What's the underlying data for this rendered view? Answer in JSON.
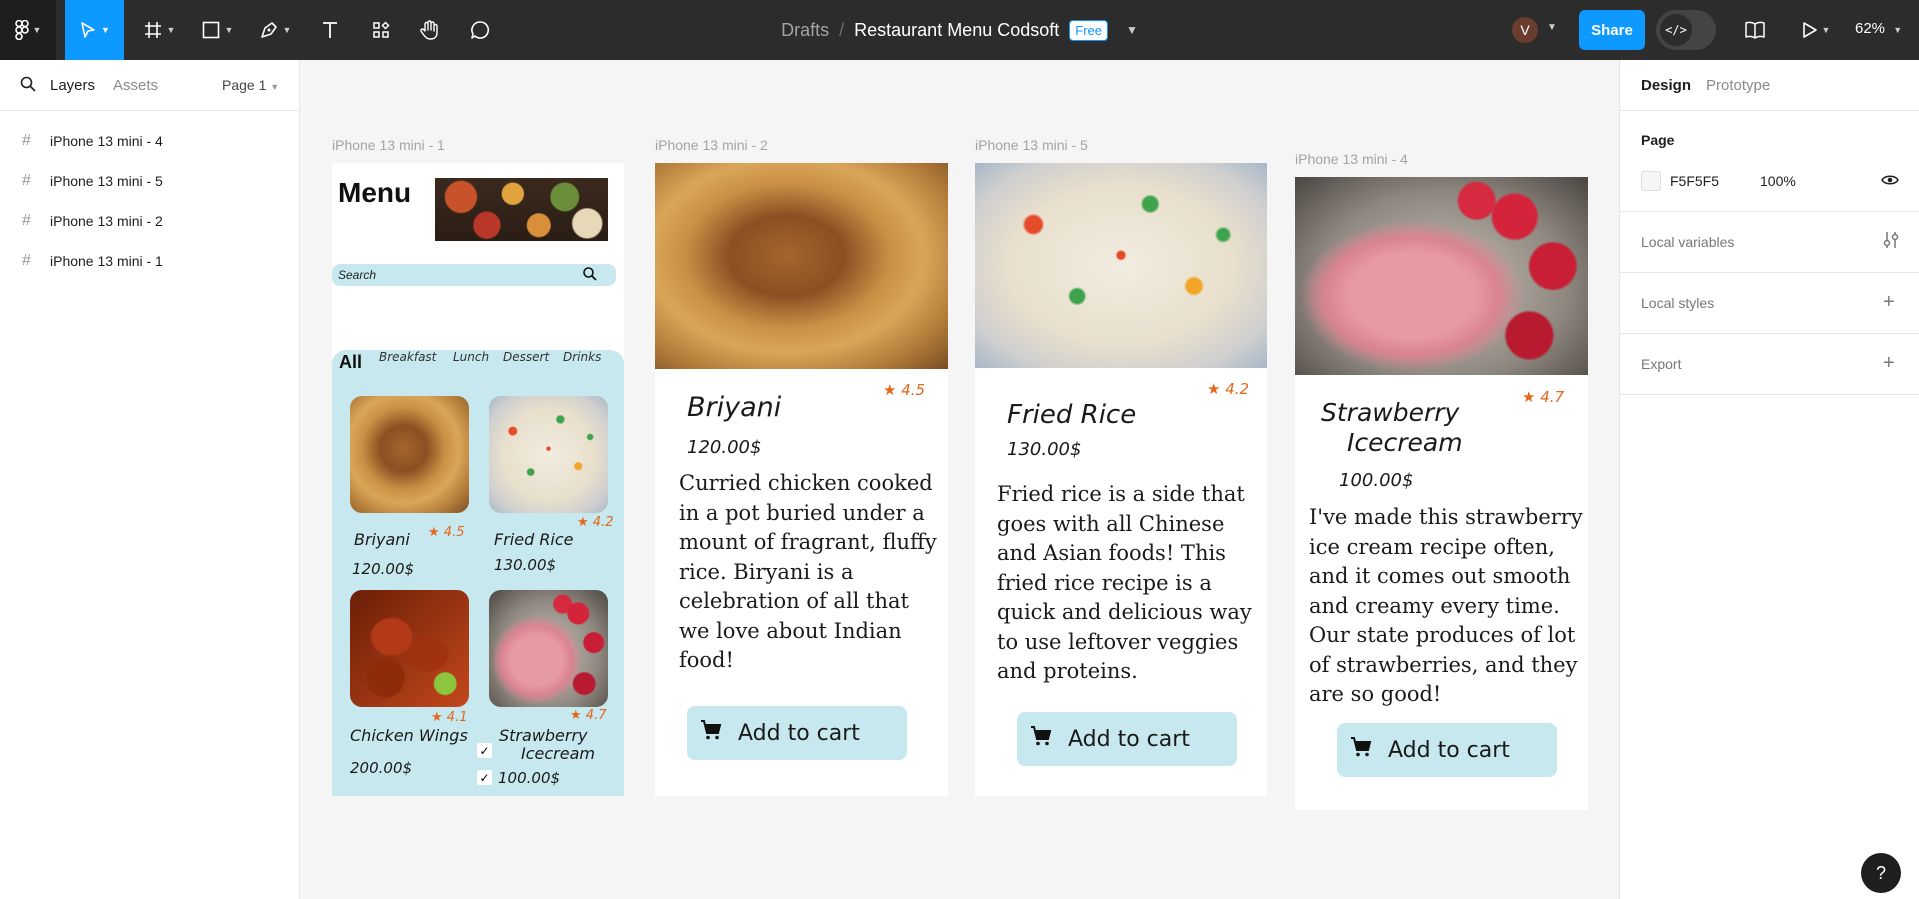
{
  "toolbar": {
    "file_location": "Drafts",
    "file_name": "Restaurant Menu Codsoft",
    "plan_badge": "Free",
    "avatar_initial": "V",
    "share_label": "Share",
    "zoom": "62%",
    "icons": [
      "figma-menu-icon",
      "move-tool-icon",
      "frame-tool-icon",
      "shape-tool-icon",
      "pen-tool-icon",
      "text-tool-icon",
      "resources-icon",
      "hand-tool-icon",
      "comment-icon",
      "dev-mode-icon",
      "library-icon",
      "present-icon"
    ]
  },
  "left_panel": {
    "tabs": {
      "layers": "Layers",
      "assets": "Assets"
    },
    "page_selector": "Page 1",
    "layers": [
      "iPhone 13 mini - 4",
      "iPhone 13 mini - 5",
      "iPhone 13 mini - 2",
      "iPhone 13 mini - 1"
    ]
  },
  "right_panel": {
    "tabs": {
      "design": "Design",
      "prototype": "Prototype"
    },
    "page_section": {
      "title": "Page",
      "color_hex": "F5F5F5",
      "opacity": "100%"
    },
    "sections": [
      "Local variables",
      "Local styles",
      "Export"
    ]
  },
  "canvas": {
    "frame1": {
      "label": "iPhone 13 mini - 1",
      "title": "Menu",
      "search_placeholder": "Search",
      "tabs": [
        "All",
        "Breakfast",
        "Lunch",
        "Dessert",
        "Drinks"
      ],
      "items": [
        {
          "name": "Briyani",
          "price": "120.00$",
          "rating": "4.5"
        },
        {
          "name": "Fried Rice",
          "price": "130.00$",
          "rating": "4.2"
        },
        {
          "name": "Chicken Wings",
          "price": "200.00$",
          "rating": "4.1"
        },
        {
          "name": "Strawberry Icecream",
          "name_line1": "Strawberry",
          "name_line2": "Icecream",
          "price": "100.00$",
          "rating": "4.7"
        }
      ]
    },
    "frame2": {
      "label": "iPhone 13 mini - 2",
      "name": "Briyani",
      "price": "120.00$",
      "rating": "4.5",
      "description": "Curried chicken cooked in a pot buried under a mount of fragrant, fluffy rice. Biryani is a celebration of all that we love about Indian food!",
      "button": "Add to cart"
    },
    "frame5": {
      "label": "iPhone 13 mini - 5",
      "name": "Fried Rice",
      "price": "130.00$",
      "rating": "4.2",
      "description": "Fried rice is a side that goes with all Chinese and Asian foods! This fried rice recipe is a quick and delicious way to use leftover veggies and proteins.",
      "button": "Add to cart"
    },
    "frame4": {
      "label": "iPhone 13 mini - 4",
      "name_line1": "Strawberry",
      "name_line2": "Icecream",
      "price": "100.00$",
      "rating": "4.7",
      "description": "I've made this strawberry ice cream recipe often, and it comes out smooth and creamy every time. Our state produces of lot of strawberries, and they are so good!",
      "button": "Add to cart"
    }
  },
  "help_label": "?"
}
